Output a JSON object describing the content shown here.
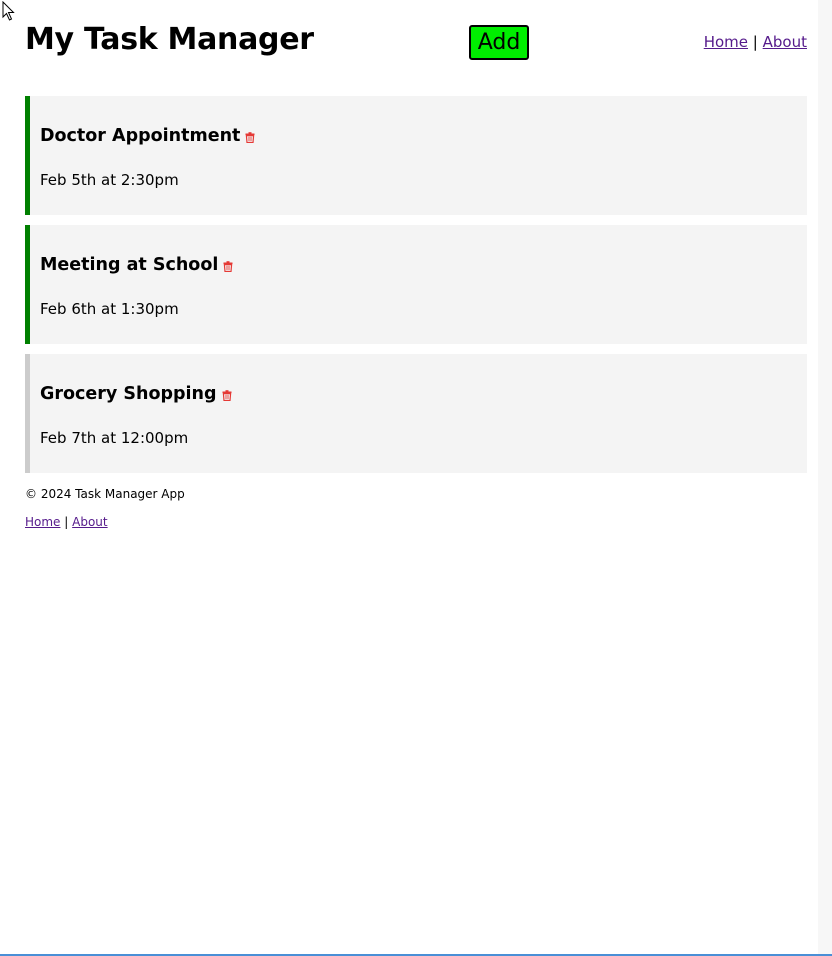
{
  "header": {
    "title": "My Task Manager",
    "add_label": "Add",
    "nav": {
      "home": "Home",
      "separator": "|",
      "about": "About"
    }
  },
  "tasks": [
    {
      "text": "Doctor Appointment",
      "day": "Feb 5th at 2:30pm",
      "reminder": true
    },
    {
      "text": "Meeting at School",
      "day": "Feb 6th at 1:30pm",
      "reminder": true
    },
    {
      "text": "Grocery Shopping",
      "day": "Feb 7th at 12:00pm",
      "reminder": false
    }
  ],
  "footer": {
    "copyright": "© 2024 Task Manager App",
    "nav": {
      "home": "Home",
      "separator": "|",
      "about": "About"
    }
  },
  "icons": {
    "delete": "trash-icon",
    "cursor": "mouse-pointer-icon"
  },
  "colors": {
    "add_button": "#00ee00",
    "reminder_border": "#008000",
    "no_reminder_border": "#cccccc",
    "task_background": "#f4f4f4",
    "delete_icon": "#e53935",
    "link": "#551a8b"
  }
}
